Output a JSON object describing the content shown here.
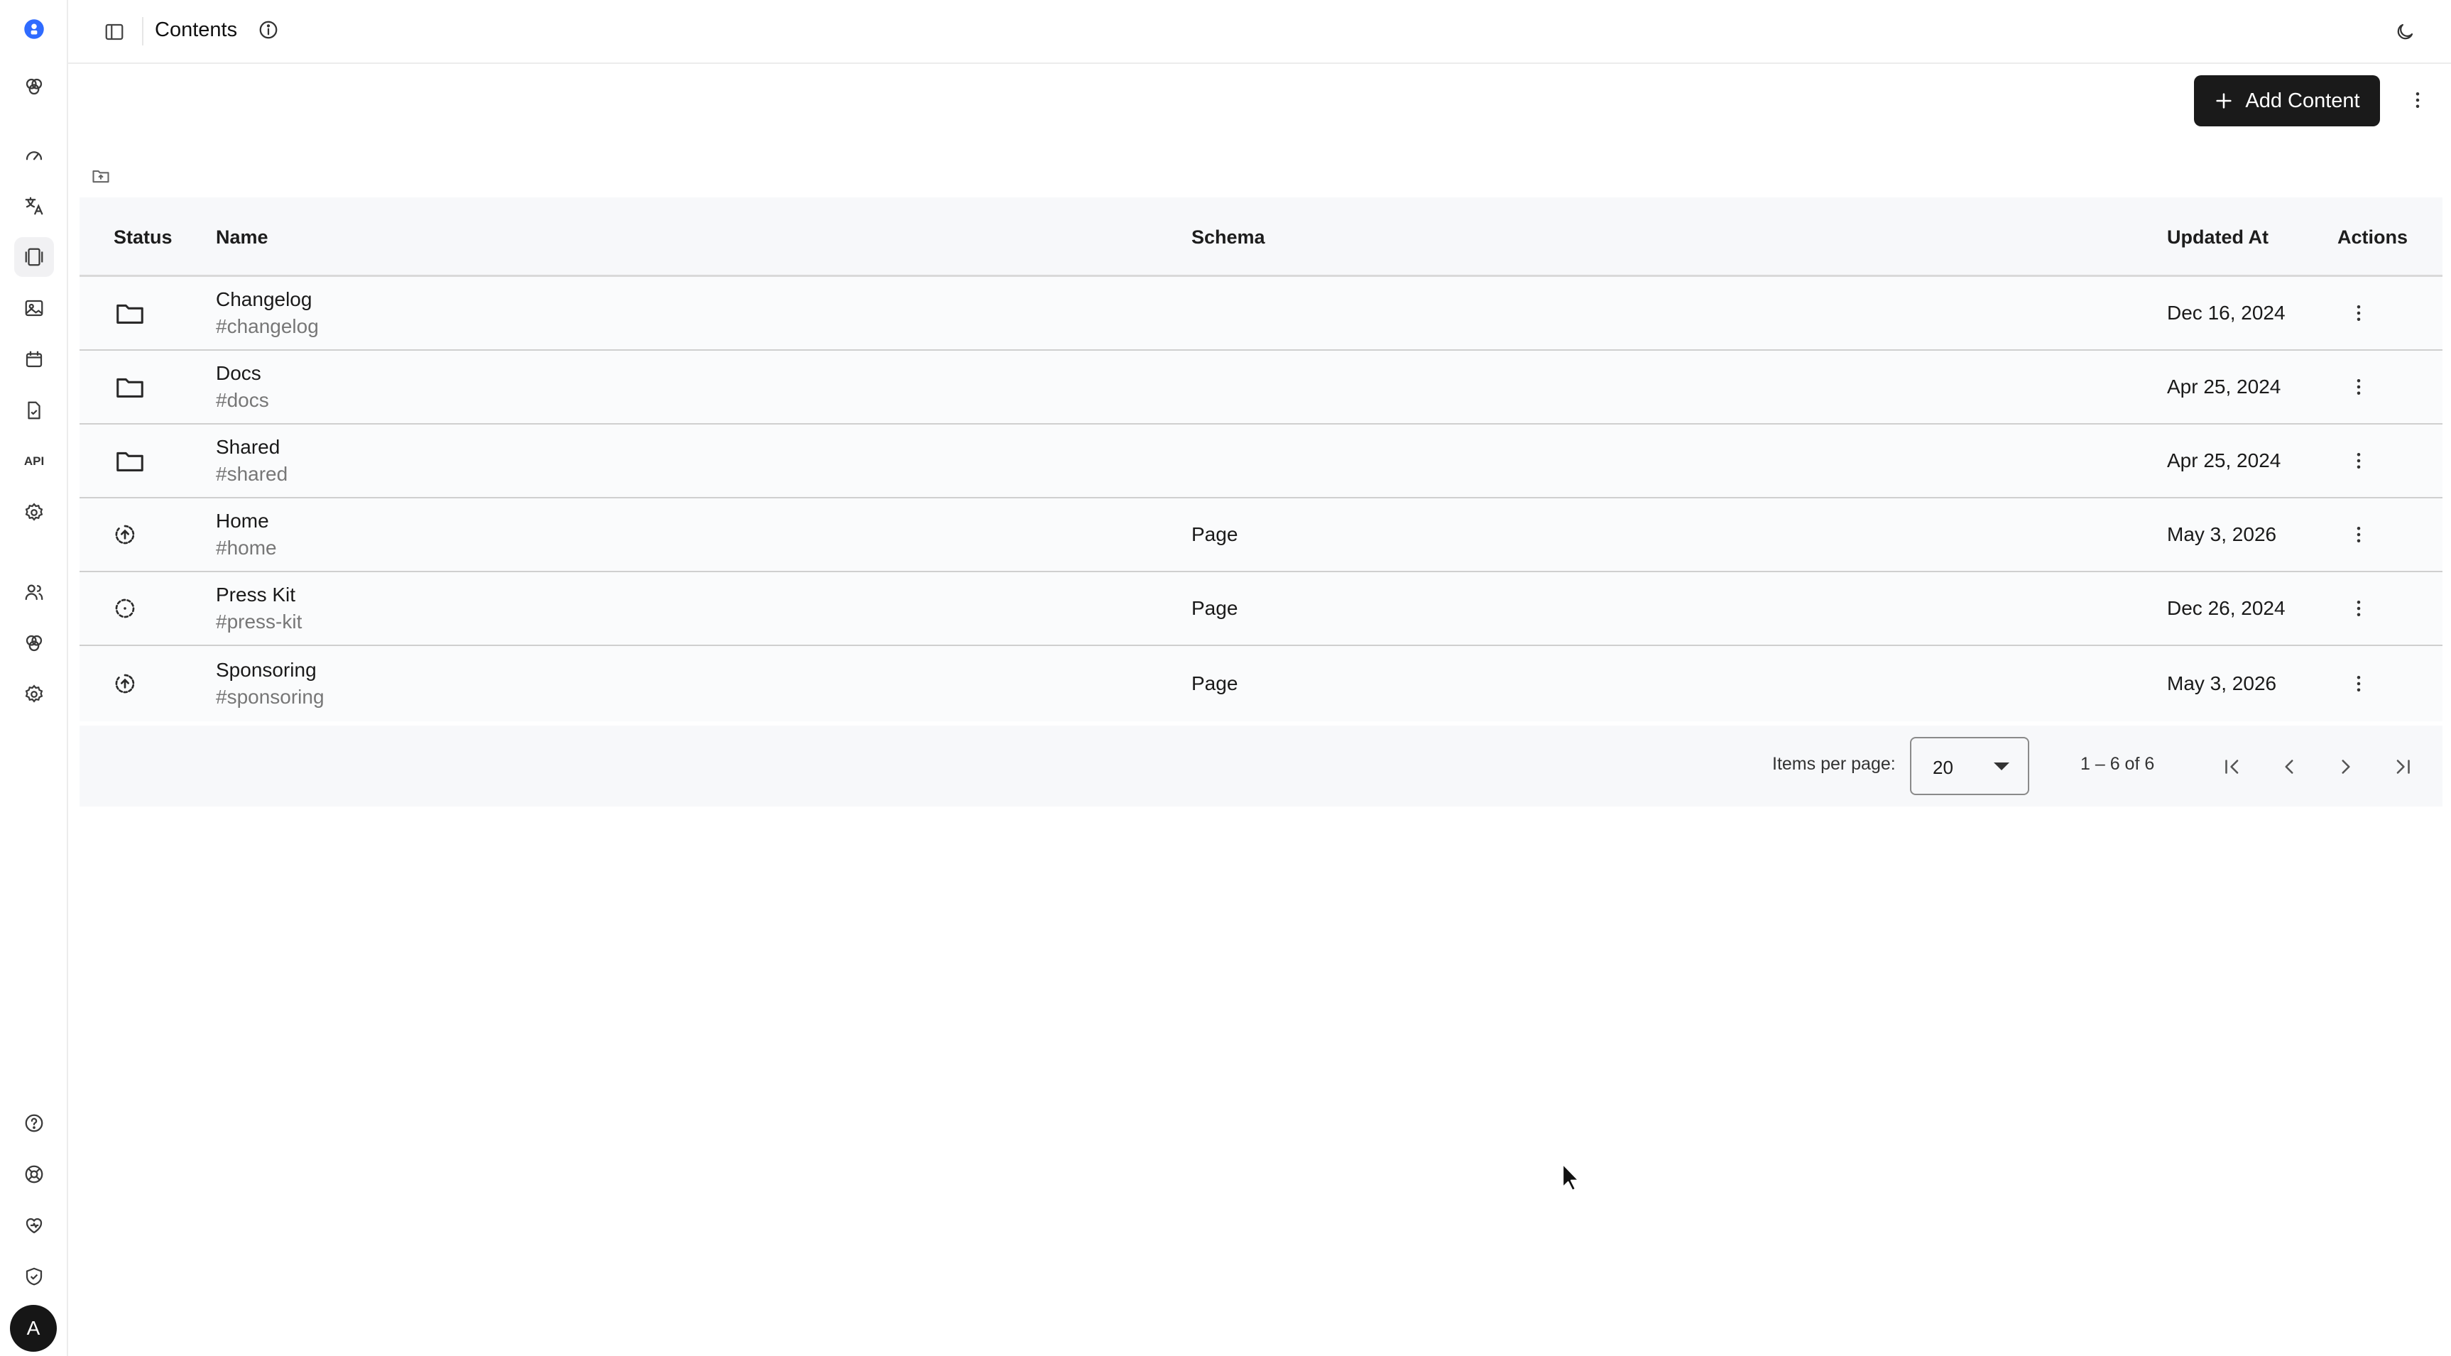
{
  "topbar": {
    "title": "Contents"
  },
  "toolbar": {
    "add_label": "Add Content"
  },
  "rail": {
    "api_label": "API",
    "avatar_initial": "A"
  },
  "table": {
    "headers": {
      "status": "Status",
      "name": "Name",
      "schema": "Schema",
      "updated": "Updated At",
      "actions": "Actions"
    },
    "rows": [
      {
        "status_icon": "folder-icon",
        "name": "Changelog",
        "slug": "#changelog",
        "schema": "",
        "updated": "Dec 16, 2024"
      },
      {
        "status_icon": "folder-icon",
        "name": "Docs",
        "slug": "#docs",
        "schema": "",
        "updated": "Apr 25, 2024"
      },
      {
        "status_icon": "folder-icon",
        "name": "Shared",
        "slug": "#shared",
        "schema": "",
        "updated": "Apr 25, 2024"
      },
      {
        "status_icon": "published-icon",
        "name": "Home",
        "slug": "#home",
        "schema": "Page",
        "updated": "May 3, 2026"
      },
      {
        "status_icon": "draft-icon",
        "name": "Press Kit",
        "slug": "#press-kit",
        "schema": "Page",
        "updated": "Dec 26, 2024"
      },
      {
        "status_icon": "published-icon",
        "name": "Sponsoring",
        "slug": "#sponsoring",
        "schema": "Page",
        "updated": "May 3, 2026"
      }
    ]
  },
  "pager": {
    "items_per_page_label": "Items per page:",
    "items_per_page_value": "20",
    "range": "1 – 6 of 6"
  }
}
